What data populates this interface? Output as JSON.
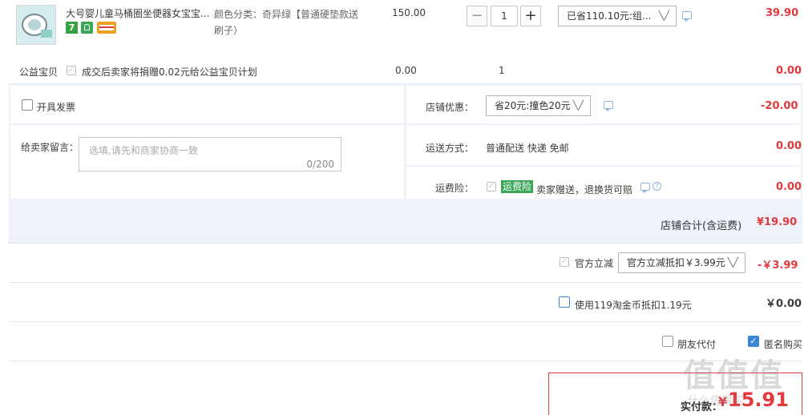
{
  "item": {
    "title": "大号婴儿童马桶圈坐便器女宝宝...",
    "badge_seven": "7",
    "spec_line1": "颜色分类：奇异绿【普通硬垫款送",
    "spec_line2": "刷子）",
    "unit_price": "150.00",
    "quantity": "1",
    "discount_select": "已省110.10元:组...",
    "subtotal": "39.90"
  },
  "charity": {
    "label": "公益宝贝",
    "text": "成交后卖家将捐赠0.02元给公益宝贝计划",
    "price": "0.00",
    "qty": "1",
    "subtotal": "0.00"
  },
  "invoice": {
    "label": "开具发票"
  },
  "shop_discount": {
    "label": "店铺优惠：",
    "select": "省20元:撞色20元",
    "amount": "-20.00"
  },
  "message": {
    "label": "给卖家留言：",
    "placeholder": "选填,请先和商家协商一致",
    "count": "0/200"
  },
  "shipping": {
    "label": "运送方式：",
    "value": "普通配送 快递 免邮",
    "amount": "0.00"
  },
  "insurance": {
    "label": "运费险：",
    "tag": "运费险",
    "text": "卖家赠送，退换货可赔",
    "amount": "0.00"
  },
  "shop_total": {
    "label": "店铺合计(含运费)",
    "amount": "¥19.90"
  },
  "official": {
    "label": "官方立减",
    "select": "官方立减抵扣￥3.99元",
    "amount": "-￥3.99"
  },
  "coins": {
    "label": "使用119淘金币抵扣1.19元",
    "amount": "￥0.00"
  },
  "friend_pay": {
    "label": "朋友代付"
  },
  "anon": {
    "label": "匿名购买"
  },
  "pay": {
    "label": "实付款：",
    "amount": "15.91"
  },
  "watermark": {
    "main": "值值值",
    "sub": "什么值得买"
  },
  "colors": {
    "accent_red": "#e4393c",
    "band_blue": "#eef3fb",
    "green_tag": "#3aa757",
    "check_blue": "#3b86d6"
  }
}
